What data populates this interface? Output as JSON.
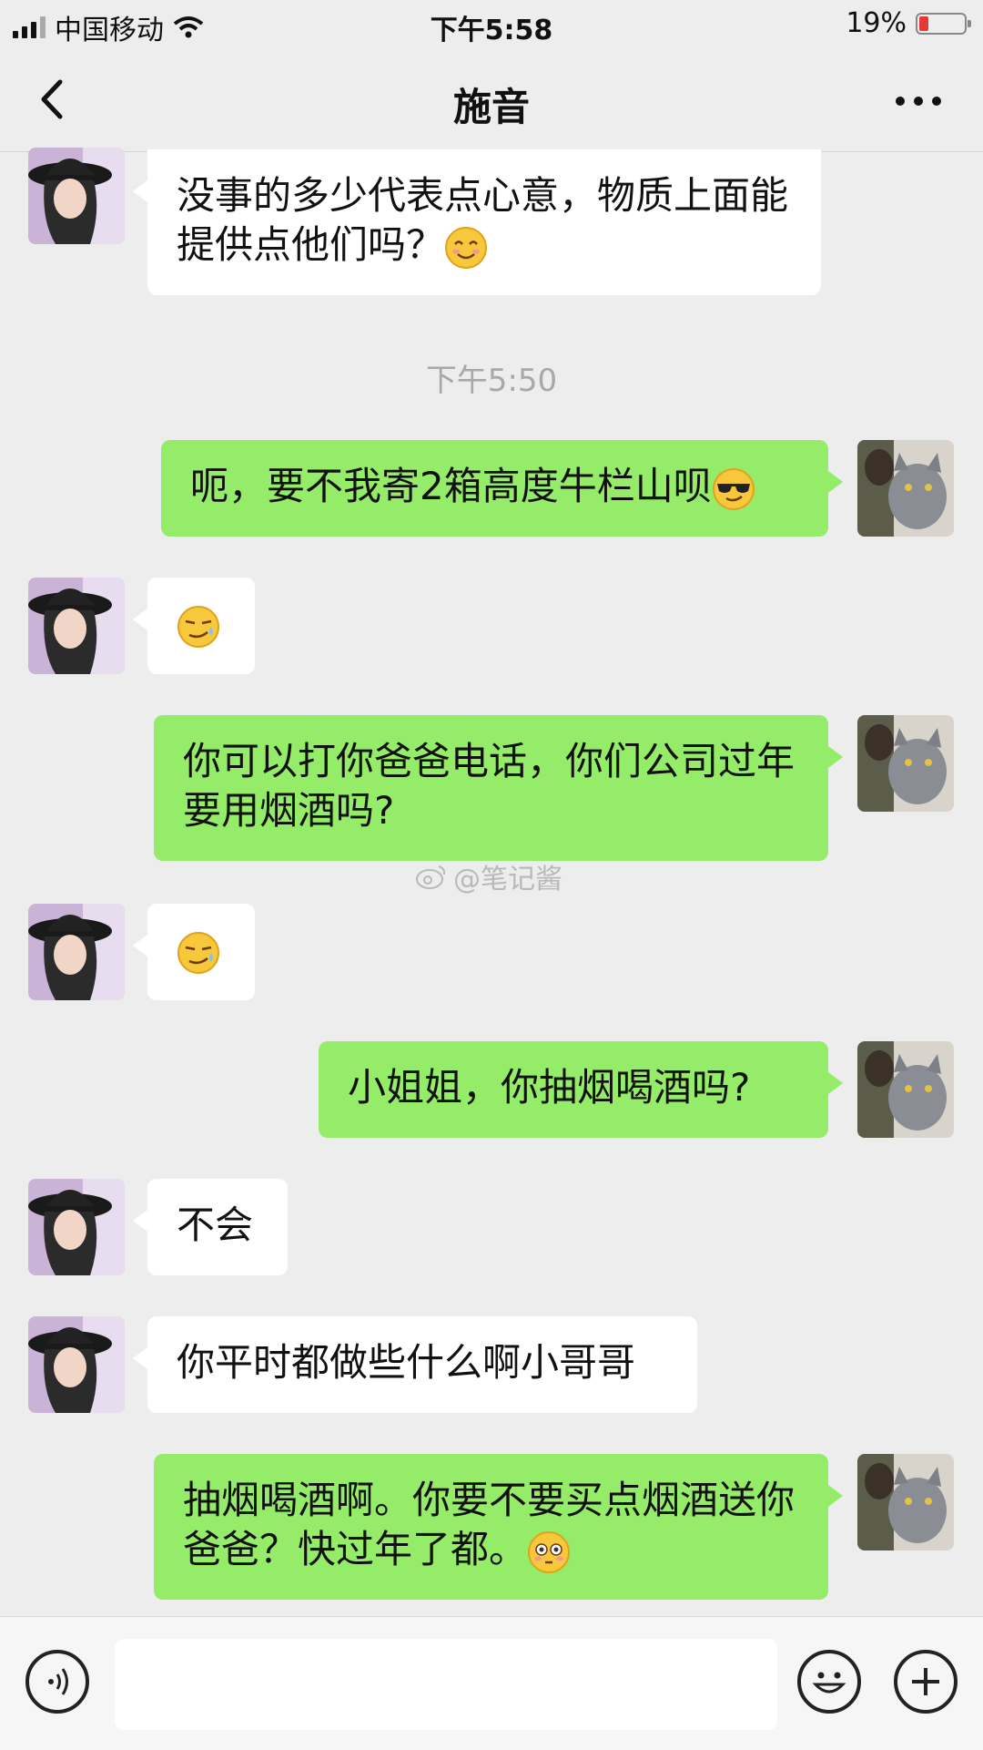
{
  "status_bar": {
    "carrier": "中国移动",
    "time": "下午5:58",
    "battery": "19%",
    "battery_level": 0.19
  },
  "header": {
    "title": "施音"
  },
  "messages": [
    {
      "side": "in",
      "text": "没事的多少代表点心意，物质上面能提供点他们吗？",
      "emoji": "smiling-blush-emoji"
    },
    {
      "side": "out",
      "text": "呃，要不我寄2箱高度牛栏山呗",
      "emoji": "sunglasses-emoji"
    },
    {
      "side": "in",
      "text": "",
      "emoji": "sweat-smile-emoji"
    },
    {
      "side": "out",
      "text": "你可以打你爸爸电话，你们公司过年要用烟酒吗?",
      "emoji": ""
    },
    {
      "side": "in",
      "text": "",
      "emoji": "sweat-smile-emoji"
    },
    {
      "side": "out",
      "text": "小姐姐，你抽烟喝酒吗?",
      "emoji": ""
    },
    {
      "side": "in",
      "text": "不会",
      "emoji": ""
    },
    {
      "side": "in",
      "text": "你平时都做些什么啊小哥哥",
      "emoji": ""
    },
    {
      "side": "out",
      "text": "抽烟喝酒啊。你要不要买点烟酒送你爸爸？快过年了都。",
      "emoji": "flushed-emoji"
    }
  ],
  "timestamp": "下午5:50",
  "watermark": "@笔记酱",
  "input": {
    "placeholder": ""
  },
  "colors": {
    "background": "#ededed",
    "incoming": "#ffffff",
    "outgoing": "#95ec69"
  }
}
